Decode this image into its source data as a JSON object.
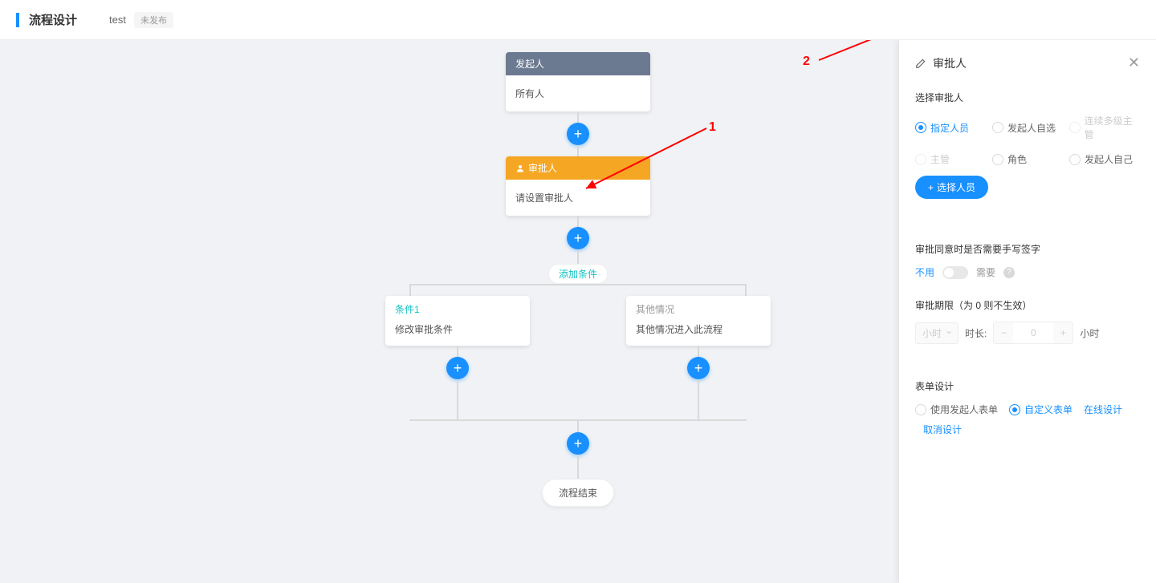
{
  "header": {
    "title": "流程设计",
    "subtitle": "test",
    "badge": "未发布"
  },
  "flow": {
    "initiator": {
      "title": "发起人",
      "body": "所有人"
    },
    "approver": {
      "title": "审批人",
      "body": "请设置审批人"
    },
    "addCondition": "添加条件",
    "branch1": {
      "title": "条件1",
      "body": "修改审批条件"
    },
    "branch2": {
      "title": "其他情况",
      "body": "其他情况进入此流程"
    },
    "end": "流程结束"
  },
  "annotations": {
    "one": "1",
    "two": "2"
  },
  "panel": {
    "title": "审批人",
    "selectApprover": "选择审批人",
    "radios": {
      "designated": "指定人员",
      "selfSelect": "发起人自选",
      "multiLevel": "连续多级主管",
      "supervisor": "主管",
      "role": "角色",
      "self": "发起人自己"
    },
    "selectPersonBtn": "选择人员",
    "signatureLabel": "审批同意时是否需要手写签字",
    "switchOff": "不用",
    "switchOn": "需要",
    "deadlineLabel": "审批期限（为 0 则不生效）",
    "unitSelect": "小时",
    "durLabel": "时长:",
    "durValue": "0",
    "unitSuffix": "小时",
    "formDesignLabel": "表单设计",
    "useInitiatorForm": "使用发起人表单",
    "customForm": "自定义表单",
    "onlineDesign": "在线设计",
    "cancelDesign": "取消设计"
  }
}
